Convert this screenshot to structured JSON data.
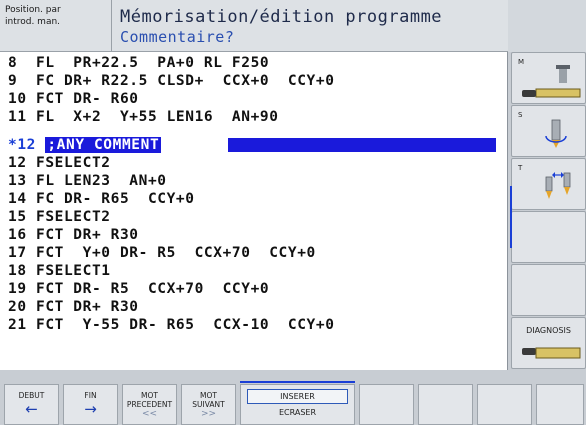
{
  "header": {
    "mode_line1": "Position. par",
    "mode_line2": "introd. man.",
    "title": "Mémorisation/édition programme",
    "subtitle": "Commentaire?"
  },
  "program": {
    "lines": [
      "8  FL  PR+22.5  PA+0 RL F250",
      "9  FC DR+ R22.5 CLSD+  CCX+0  CCY+0",
      "10 FCT DR- R60",
      "11 FL  X+2  Y+55 LEN16  AN+90",
      "*12 ",
      "12 FSELECT2",
      "13 FL LEN23  AN+0",
      "14 FC DR- R65  CCY+0",
      "15 FSELECT2",
      "16 FCT DR+ R30",
      "17 FCT  Y+0 DR- R5  CCX+70  CCY+0",
      "18 FSELECT1",
      "19 FCT DR- R5  CCX+70  CCY+0",
      "20 FCT DR+ R30",
      "21 FCT  Y-55 DR- R65  CCX-10  CCY+0"
    ],
    "active_prefix": "*12 ",
    "active_comment": ";ANY COMMENT"
  },
  "side_softkeys": {
    "m_label": "M",
    "s_label": "S",
    "t_label": "T",
    "diagnosis_label": "DIAGNOSIS"
  },
  "bottom_softkeys": {
    "debut": "DEBUT",
    "fin": "FIN",
    "mot_precedent_1": "MOT",
    "mot_precedent_2": "PRECEDENT",
    "mot_precedent_arrow": "<<",
    "mot_suivant_1": "MOT",
    "mot_suivant_2": "SUIVANT",
    "mot_suivant_arrow": ">>",
    "inserer": "INSERER",
    "ecraser": "ECRASER"
  },
  "colors": {
    "cursor": "#1a1adb",
    "accent": "#2a4fb0"
  }
}
